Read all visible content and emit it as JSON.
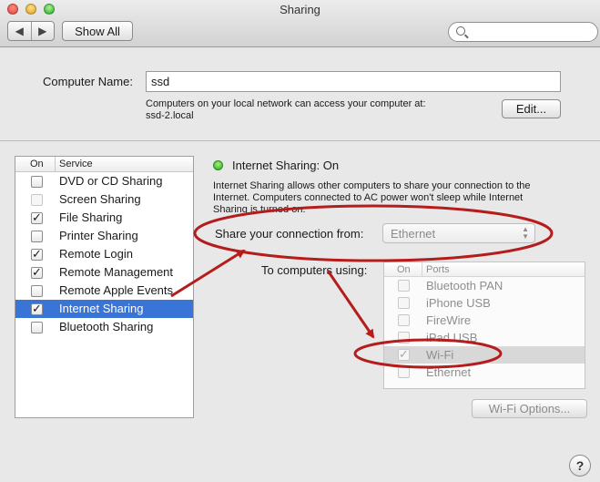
{
  "window": {
    "title": "Sharing"
  },
  "toolbar": {
    "back_icon": "chevron-left-icon",
    "forward_icon": "chevron-right-icon",
    "show_all_label": "Show All",
    "search_placeholder": ""
  },
  "computer": {
    "name_label": "Computer Name:",
    "name_value": "ssd",
    "info_line1": "Computers on your local network can access your computer at:",
    "info_line2": "ssd-2.local",
    "edit_label": "Edit..."
  },
  "services": {
    "header_on": "On",
    "header_service": "Service",
    "items": [
      {
        "label": "DVD or CD Sharing",
        "checked": false,
        "enabled": true,
        "selected": false
      },
      {
        "label": "Screen Sharing",
        "checked": false,
        "enabled": false,
        "selected": false
      },
      {
        "label": "File Sharing",
        "checked": true,
        "enabled": true,
        "selected": false
      },
      {
        "label": "Printer Sharing",
        "checked": false,
        "enabled": true,
        "selected": false
      },
      {
        "label": "Remote Login",
        "checked": true,
        "enabled": true,
        "selected": false
      },
      {
        "label": "Remote Management",
        "checked": true,
        "enabled": true,
        "selected": false
      },
      {
        "label": "Remote Apple Events",
        "checked": false,
        "enabled": true,
        "selected": false
      },
      {
        "label": "Internet Sharing",
        "checked": true,
        "enabled": true,
        "selected": true
      },
      {
        "label": "Bluetooth Sharing",
        "checked": false,
        "enabled": true,
        "selected": false
      }
    ]
  },
  "detail": {
    "status": "Internet Sharing: On",
    "status_color": "#29a81a",
    "desc_line1": "Internet Sharing allows other computers to share your connection to the",
    "desc_line2": "Internet. Computers connected to AC power won't sleep while Internet",
    "desc_line3": "Sharing is turned on.",
    "share_from_label": "Share your connection from:",
    "share_from_value": "Ethernet",
    "to_computers_label": "To computers using:",
    "ports_header_on": "On",
    "ports_header_ports": "Ports",
    "ports": [
      {
        "label": "Bluetooth PAN",
        "checked": false
      },
      {
        "label": "iPhone USB",
        "checked": false
      },
      {
        "label": "FireWire",
        "checked": false
      },
      {
        "label": "iPad USB",
        "checked": false
      },
      {
        "label": "Wi-Fi",
        "checked": true
      },
      {
        "label": "Ethernet",
        "checked": false
      }
    ],
    "wifi_options_label": "Wi-Fi Options..."
  },
  "help": {
    "label": "?"
  },
  "annotation_color": "#b51d1d"
}
